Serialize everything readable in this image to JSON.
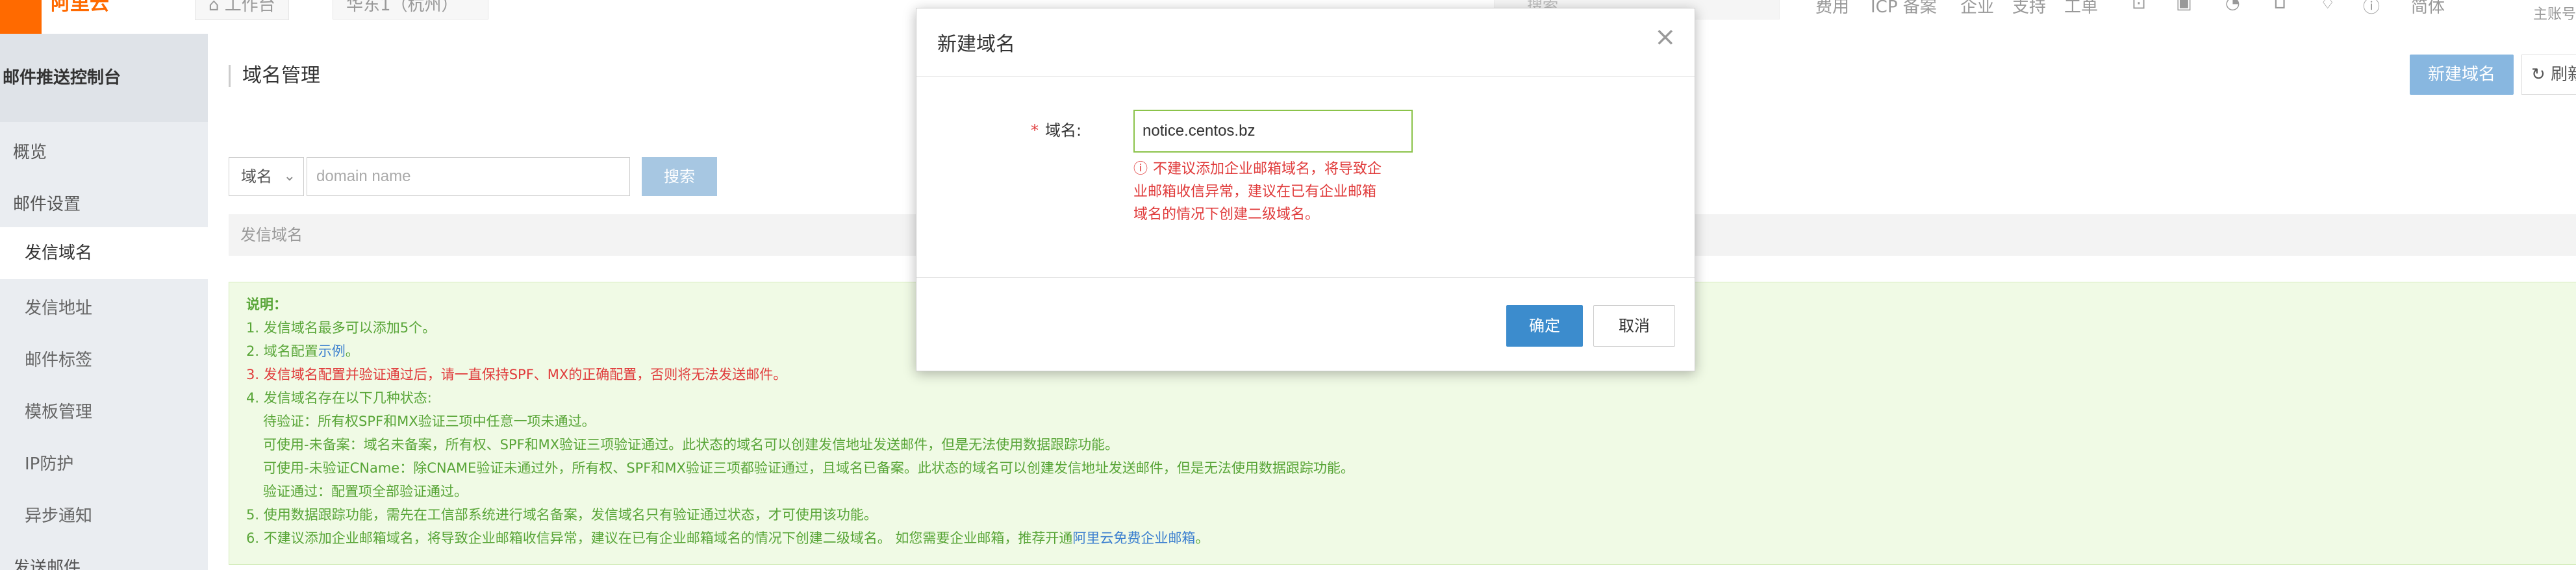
{
  "topbar": {
    "brand": "阿里云",
    "workbench_label": "工作台",
    "region_label": "华东1（杭州）",
    "search_placeholder": "搜索",
    "nav_links": [
      "费用",
      "ICP 备案",
      "企业",
      "支持",
      "工单"
    ],
    "lang_label": "简体",
    "user_label": "主账号"
  },
  "sidebar": {
    "title": "邮件推送控制台",
    "items": [
      {
        "label": "概览",
        "level": 1
      },
      {
        "label": "邮件设置",
        "level": 1
      },
      {
        "label": "发信域名",
        "level": 2,
        "active": true
      },
      {
        "label": "发信地址",
        "level": 2
      },
      {
        "label": "邮件标签",
        "level": 2
      },
      {
        "label": "模板管理",
        "level": 2
      },
      {
        "label": "IP防护",
        "level": 2
      },
      {
        "label": "异步通知",
        "level": 2
      },
      {
        "label": "发送邮件",
        "level": 1
      }
    ]
  },
  "main": {
    "page_title": "域名管理",
    "new_domain_button": "新建域名",
    "refresh_button": "刷新",
    "filter": {
      "select_value": "域名",
      "input_placeholder": "domain name",
      "search_button": "搜索"
    },
    "table": {
      "header": "发信域名"
    },
    "notice": {
      "title": "说明：",
      "lines": [
        "1. 发信域名最多可以添加5个。",
        "2. 域名配置",
        "示例",
        "。",
        "3. 发信域名配置并验证通过后，请一直保持SPF、MX的正确配置，否则将无法发送邮件。",
        "4. 发信域名存在以下几种状态:",
        "待验证：所有权SPF和MX验证三项中任意一项未通过。",
        "可使用-未备案：域名未备案，所有权、SPF和MX验证三项验证通过。此状态的域名可以创建发信地址发送邮件，但是无法使用数据跟踪功能。",
        "可使用-未验证CName：除CNAME验证未通过外，所有权、SPF和MX验证三项都验证通过，且域名已备案。此状态的域名可以创建发信地址发送邮件，但是无法使用数据跟踪功能。",
        "验证通过：配置项全部验证通过。",
        "5. 使用数据跟踪功能，需先在工信部系统进行域名备案，发信域名只有验证通过状态，才可使用该功能。",
        "6. 不建议添加企业邮箱域名，将导致企业邮箱收信异常，建议在已有企业邮箱域名的情况下创建二级域名。 如您需要企业邮箱，推荐开通",
        "阿里云免费企业邮箱",
        "。"
      ]
    }
  },
  "dialog": {
    "title": "新建域名",
    "close_symbol": "×",
    "field_label": "域名:",
    "required_mark": "*",
    "field_value": "notice.centos.bz",
    "error_icon": "!",
    "error_lines": [
      "不建议添加企业邮箱域名，将导致企",
      "业邮箱收信异常，建议在已有企业邮箱",
      "域名的情况下创建二级域名。"
    ],
    "ok_button": "确定",
    "cancel_button": "取消"
  }
}
